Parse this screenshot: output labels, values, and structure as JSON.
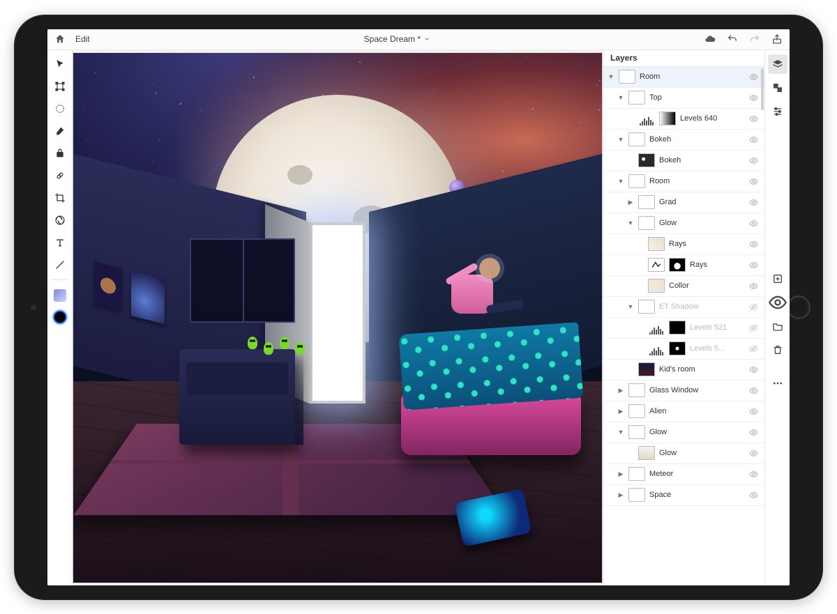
{
  "topbar": {
    "edit_label": "Edit",
    "document_title": "Space Dream *"
  },
  "tools": [
    {
      "name": "move-tool",
      "icon": "cursor"
    },
    {
      "name": "transform-tool",
      "icon": "transform"
    },
    {
      "name": "marquee-tool",
      "icon": "marquee"
    },
    {
      "name": "brush-tool",
      "icon": "brush"
    },
    {
      "name": "clone-tool",
      "icon": "clone"
    },
    {
      "name": "healing-tool",
      "icon": "heal"
    },
    {
      "name": "crop-tool",
      "icon": "crop"
    },
    {
      "name": "adjust-tool",
      "icon": "aperture"
    },
    {
      "name": "type-tool",
      "icon": "type"
    },
    {
      "name": "line-tool",
      "icon": "line"
    }
  ],
  "layers": {
    "title": "Layers",
    "items": [
      {
        "indent": 0,
        "arrow": "down",
        "kind": "folder",
        "label": "Room",
        "visible": true,
        "selected": true
      },
      {
        "indent": 1,
        "arrow": "down",
        "kind": "folder",
        "label": "Top",
        "visible": true
      },
      {
        "indent": 2,
        "arrow": "",
        "kind": "levels",
        "mask": "grad",
        "label": "Levels 640",
        "visible": true
      },
      {
        "indent": 1,
        "arrow": "down",
        "kind": "folder",
        "label": "Bokeh",
        "visible": true
      },
      {
        "indent": 2,
        "arrow": "",
        "kind": "image",
        "thumbStyle": "bokeh",
        "label": "Bokeh",
        "visible": true
      },
      {
        "indent": 1,
        "arrow": "down",
        "kind": "folder",
        "label": "Room",
        "visible": true
      },
      {
        "indent": 2,
        "arrow": "right",
        "kind": "folder",
        "label": "Grad",
        "visible": true
      },
      {
        "indent": 2,
        "arrow": "down",
        "kind": "folder",
        "label": "Glow",
        "visible": true
      },
      {
        "indent": 3,
        "arrow": "",
        "kind": "image",
        "thumbStyle": "rays",
        "label": "Rays",
        "visible": true
      },
      {
        "indent": 3,
        "arrow": "",
        "kind": "fxpair",
        "thumbStyle": "raysfx",
        "label": "Rays",
        "visible": true
      },
      {
        "indent": 3,
        "arrow": "",
        "kind": "image",
        "thumbStyle": "collor",
        "label": "Collor",
        "visible": true
      },
      {
        "indent": 2,
        "arrow": "down",
        "kind": "folder",
        "label": "ET Shadow",
        "visible": false
      },
      {
        "indent": 3,
        "arrow": "",
        "kind": "levels",
        "mask": "black",
        "label": "Levels 521",
        "visible": false
      },
      {
        "indent": 3,
        "arrow": "",
        "kind": "levels",
        "mask": "blackdot",
        "label": "Levels 5...",
        "visible": false
      },
      {
        "indent": 2,
        "arrow": "",
        "kind": "image",
        "thumbStyle": "kidsroom",
        "label": "Kid's room",
        "visible": true
      },
      {
        "indent": 1,
        "arrow": "right",
        "kind": "folder",
        "label": "Glass Window",
        "visible": true
      },
      {
        "indent": 1,
        "arrow": "right",
        "kind": "folder",
        "label": "Alien",
        "visible": true
      },
      {
        "indent": 1,
        "arrow": "down",
        "kind": "folder",
        "label": "Glow",
        "visible": true
      },
      {
        "indent": 2,
        "arrow": "",
        "kind": "image",
        "thumbStyle": "glow",
        "label": "Glow",
        "visible": true
      },
      {
        "indent": 1,
        "arrow": "right",
        "kind": "folder",
        "label": "Meteor",
        "visible": true
      },
      {
        "indent": 1,
        "arrow": "right",
        "kind": "folder",
        "label": "Space",
        "visible": true
      }
    ]
  },
  "right_rail": [
    {
      "name": "layers-panel-toggle",
      "icon": "layers",
      "active": true
    },
    {
      "name": "layer-properties",
      "icon": "swap"
    },
    {
      "name": "adjustments",
      "icon": "sliders"
    }
  ],
  "right_rail_mid": [
    {
      "name": "add-layer",
      "icon": "plus-box"
    },
    {
      "name": "visibility",
      "icon": "eye"
    },
    {
      "name": "folder",
      "icon": "folder"
    },
    {
      "name": "delete",
      "icon": "trash"
    }
  ],
  "right_rail_bottom": [
    {
      "name": "more",
      "icon": "dots"
    }
  ]
}
